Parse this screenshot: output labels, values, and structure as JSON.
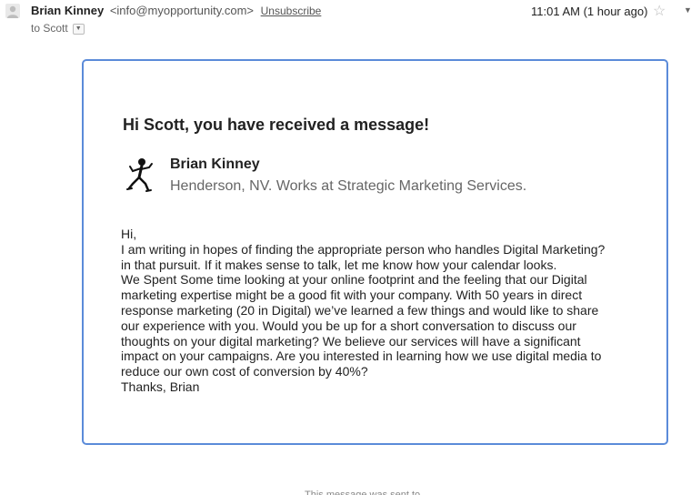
{
  "header": {
    "sender_name": "Brian Kinney",
    "sender_email": "<info@myopportunity.com>",
    "unsubscribe_label": "Unsubscribe",
    "time": "11:01 AM (1 hour ago)",
    "to_label": "to Scott"
  },
  "card": {
    "headline": "Hi Scott, you have received a message!",
    "profile_name": "Brian Kinney",
    "profile_sub": "Henderson, NV. Works at Strategic Marketing Services.",
    "message_lines": [
      "Hi,",
      "I am writing in hopes of finding the appropriate person who handles Digital Marketing?",
      "in that pursuit. If it makes sense to talk, let me know how your calendar looks.",
      "We Spent Some time looking at your online footprint and the feeling that our Digital",
      "marketing expertise might be a good fit with your company. With 50 years in direct",
      "response marketing (20 in Digital) we’ve learned a few things and would like to share",
      "our experience with you. Would you be up for a short conversation to discuss our",
      "thoughts on your digital marketing? We believe our services will have a significant",
      "impact on your campaigns. Are you interested in learning how we use digital media to",
      "reduce our own cost of conversion by 40%?",
      "Thanks, Brian"
    ]
  },
  "footer": {
    "partial_text": "This message was sent to"
  },
  "colors": {
    "card_border": "#5b8bd9"
  }
}
